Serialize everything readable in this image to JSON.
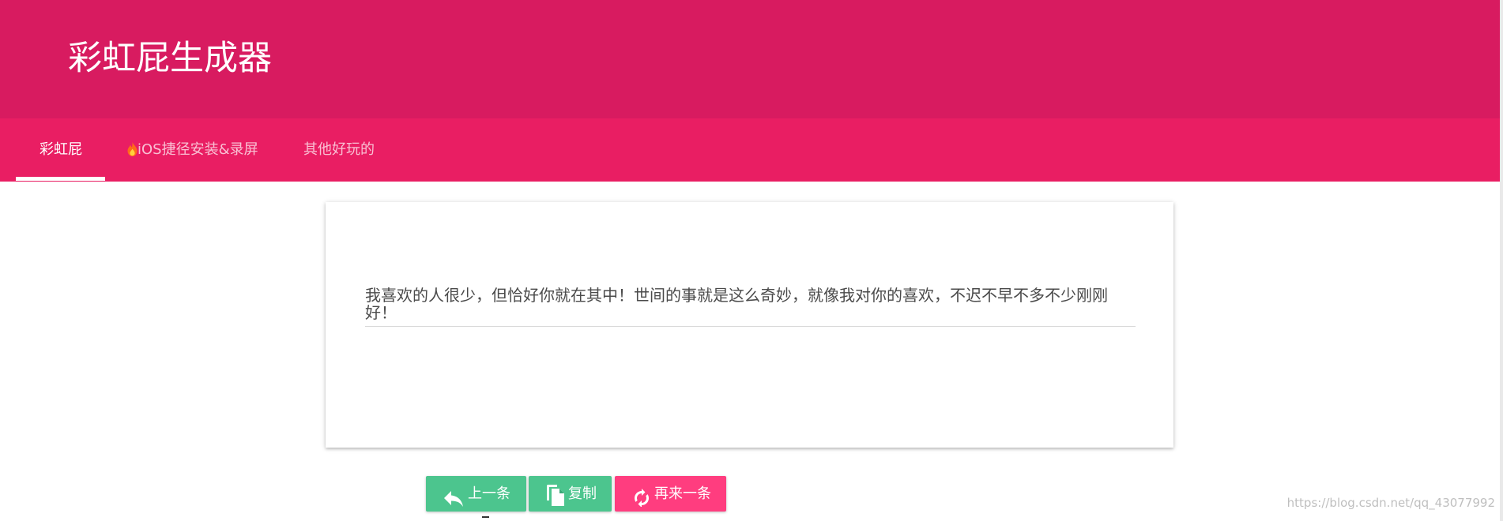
{
  "header": {
    "title": "彩虹屁生成器"
  },
  "tabs": [
    {
      "label": "彩虹屁",
      "active": true
    },
    {
      "label": "iOS捷径安装&录屏",
      "icon": "fire-icon",
      "active": false
    },
    {
      "label": "其他好玩的",
      "active": false
    }
  ],
  "card": {
    "text": "我喜欢的人很少，但恰好你就在其中！世间的事就是这么奇妙，就像我对你的喜欢，不迟不早不多不少刚刚好！"
  },
  "buttons": {
    "prev": {
      "label": "上一条",
      "icon": "reply-arrow-icon"
    },
    "copy": {
      "label": "复制",
      "icon": "copy-icon"
    },
    "next": {
      "label": "再来一条",
      "icon": "refresh-icon"
    }
  },
  "watermark": "https://blog.csdn.net/qq_43077992",
  "colors": {
    "header": "#d81b60",
    "tabbar": "#e91e63",
    "button_green": "#4cc58e",
    "button_pink": "#ff3d7f"
  }
}
